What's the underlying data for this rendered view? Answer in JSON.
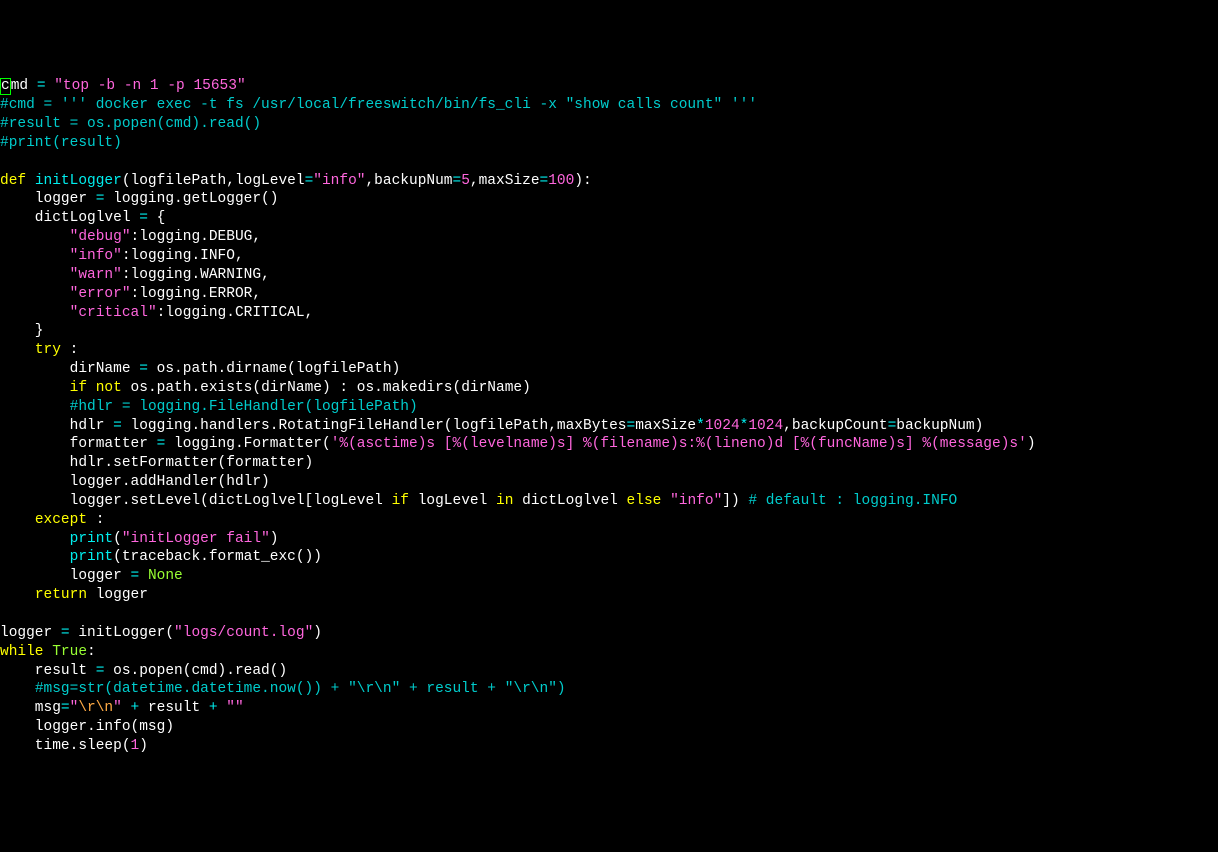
{
  "lines": [
    [
      {
        "cls": "white cursor",
        "t": "c"
      },
      {
        "cls": "white",
        "t": "md "
      },
      {
        "cls": "cyan",
        "t": "= "
      },
      {
        "cls": "pink",
        "t": "\"top -b -n 1 -p 15653\""
      }
    ],
    [
      {
        "cls": "teal",
        "t": "#cmd = ''' docker exec -t fs /usr/local/freeswitch/bin/fs_cli -x \"show calls count\" '''"
      }
    ],
    [
      {
        "cls": "teal",
        "t": "#result = os.popen(cmd).read()"
      }
    ],
    [
      {
        "cls": "teal",
        "t": "#print(result)"
      }
    ],
    [],
    [
      {
        "cls": "yellow",
        "t": "def "
      },
      {
        "cls": "cyan",
        "t": "initLogger"
      },
      {
        "cls": "white",
        "t": "(logfilePath,logLevel"
      },
      {
        "cls": "cyan",
        "t": "="
      },
      {
        "cls": "pink",
        "t": "\"info\""
      },
      {
        "cls": "white",
        "t": ",backupNum"
      },
      {
        "cls": "cyan",
        "t": "="
      },
      {
        "cls": "pink",
        "t": "5"
      },
      {
        "cls": "white",
        "t": ",maxSize"
      },
      {
        "cls": "cyan",
        "t": "="
      },
      {
        "cls": "pink",
        "t": "100"
      },
      {
        "cls": "white",
        "t": "):"
      }
    ],
    [
      {
        "cls": "white",
        "t": "    logger "
      },
      {
        "cls": "cyan",
        "t": "= "
      },
      {
        "cls": "white",
        "t": "logging.getLogger()"
      }
    ],
    [
      {
        "cls": "white",
        "t": "    dictLoglvel "
      },
      {
        "cls": "cyan",
        "t": "= "
      },
      {
        "cls": "white",
        "t": "{"
      }
    ],
    [
      {
        "cls": "white",
        "t": "        "
      },
      {
        "cls": "pink",
        "t": "\"debug\""
      },
      {
        "cls": "white",
        "t": ":logging.DEBUG,"
      }
    ],
    [
      {
        "cls": "white",
        "t": "        "
      },
      {
        "cls": "pink",
        "t": "\"info\""
      },
      {
        "cls": "white",
        "t": ":logging.INFO,"
      }
    ],
    [
      {
        "cls": "white",
        "t": "        "
      },
      {
        "cls": "pink",
        "t": "\"warn\""
      },
      {
        "cls": "white",
        "t": ":logging.WARNING,"
      }
    ],
    [
      {
        "cls": "white",
        "t": "        "
      },
      {
        "cls": "pink",
        "t": "\"error\""
      },
      {
        "cls": "white",
        "t": ":logging.ERROR,"
      }
    ],
    [
      {
        "cls": "white",
        "t": "        "
      },
      {
        "cls": "pink",
        "t": "\"critical\""
      },
      {
        "cls": "white",
        "t": ":logging.CRITICAL,"
      }
    ],
    [
      {
        "cls": "white",
        "t": "    }"
      }
    ],
    [
      {
        "cls": "white",
        "t": "    "
      },
      {
        "cls": "yellow",
        "t": "try "
      },
      {
        "cls": "white",
        "t": ":"
      }
    ],
    [
      {
        "cls": "white",
        "t": "        dirName "
      },
      {
        "cls": "cyan",
        "t": "= "
      },
      {
        "cls": "white",
        "t": "os.path.dirname(logfilePath)"
      }
    ],
    [
      {
        "cls": "white",
        "t": "        "
      },
      {
        "cls": "yellow",
        "t": "if "
      },
      {
        "cls": "yellow",
        "t": "not "
      },
      {
        "cls": "white",
        "t": "os.path.exists(dirName) : os.makedirs(dirName)"
      }
    ],
    [
      {
        "cls": "white",
        "t": "        "
      },
      {
        "cls": "teal",
        "t": "#hdlr = logging.FileHandler(logfilePath)"
      }
    ],
    [
      {
        "cls": "white",
        "t": "        hdlr "
      },
      {
        "cls": "cyan",
        "t": "= "
      },
      {
        "cls": "white",
        "t": "logging.handlers.RotatingFileHandler(logfilePath,maxBytes"
      },
      {
        "cls": "cyan",
        "t": "="
      },
      {
        "cls": "white",
        "t": "maxSize"
      },
      {
        "cls": "cyan",
        "t": "*"
      },
      {
        "cls": "pink",
        "t": "1024"
      },
      {
        "cls": "cyan",
        "t": "*"
      },
      {
        "cls": "pink",
        "t": "1024"
      },
      {
        "cls": "white",
        "t": ",backupCount"
      },
      {
        "cls": "cyan",
        "t": "="
      },
      {
        "cls": "white",
        "t": "backupNum)"
      }
    ],
    [
      {
        "cls": "white",
        "t": "        formatter "
      },
      {
        "cls": "cyan",
        "t": "= "
      },
      {
        "cls": "white",
        "t": "logging.Formatter("
      },
      {
        "cls": "pink",
        "t": "'%(asctime)s [%(levelname)s] %(filename)s:%(lineno)d [%(funcName)s] %(message)s'"
      },
      {
        "cls": "white",
        "t": ")"
      }
    ],
    [
      {
        "cls": "white",
        "t": "        hdlr.setFormatter(formatter)"
      }
    ],
    [
      {
        "cls": "white",
        "t": "        logger.addHandler(hdlr)"
      }
    ],
    [
      {
        "cls": "white",
        "t": "        logger.setLevel(dictLoglvel[logLevel "
      },
      {
        "cls": "yellow",
        "t": "if "
      },
      {
        "cls": "white",
        "t": "logLevel "
      },
      {
        "cls": "yellow",
        "t": "in "
      },
      {
        "cls": "white",
        "t": "dictLoglvel "
      },
      {
        "cls": "yellow",
        "t": "else "
      },
      {
        "cls": "pink",
        "t": "\"info\""
      },
      {
        "cls": "white",
        "t": "]) "
      },
      {
        "cls": "teal",
        "t": "# default : logging.INFO"
      }
    ],
    [
      {
        "cls": "white",
        "t": "    "
      },
      {
        "cls": "yellow",
        "t": "except "
      },
      {
        "cls": "white",
        "t": ":"
      }
    ],
    [
      {
        "cls": "white",
        "t": "        "
      },
      {
        "cls": "cyan",
        "t": "print"
      },
      {
        "cls": "white",
        "t": "("
      },
      {
        "cls": "pink",
        "t": "\"initLogger fail\""
      },
      {
        "cls": "white",
        "t": ")"
      }
    ],
    [
      {
        "cls": "white",
        "t": "        "
      },
      {
        "cls": "cyan",
        "t": "print"
      },
      {
        "cls": "white",
        "t": "(traceback.format_exc())"
      }
    ],
    [
      {
        "cls": "white",
        "t": "        logger "
      },
      {
        "cls": "cyan",
        "t": "= "
      },
      {
        "cls": "lime",
        "t": "None"
      }
    ],
    [
      {
        "cls": "white",
        "t": "    "
      },
      {
        "cls": "yellow",
        "t": "return "
      },
      {
        "cls": "white",
        "t": "logger"
      }
    ],
    [],
    [
      {
        "cls": "white",
        "t": "logger "
      },
      {
        "cls": "cyan",
        "t": "= "
      },
      {
        "cls": "white",
        "t": "initLogger("
      },
      {
        "cls": "pink",
        "t": "\"logs/count.log\""
      },
      {
        "cls": "white",
        "t": ")"
      }
    ],
    [
      {
        "cls": "yellow",
        "t": "while "
      },
      {
        "cls": "lime",
        "t": "True"
      },
      {
        "cls": "white",
        "t": ":"
      }
    ],
    [
      {
        "cls": "white",
        "t": "    result "
      },
      {
        "cls": "cyan",
        "t": "= "
      },
      {
        "cls": "white",
        "t": "os.popen(cmd).read()"
      }
    ],
    [
      {
        "cls": "white",
        "t": "    "
      },
      {
        "cls": "teal",
        "t": "#msg=str(datetime.datetime.now()) + \"\\r\\n\" + result + \"\\r\\n\")"
      }
    ],
    [
      {
        "cls": "white",
        "t": "    msg"
      },
      {
        "cls": "cyan",
        "t": "="
      },
      {
        "cls": "pink",
        "t": "\""
      },
      {
        "cls": "orange",
        "t": "\\r\\n"
      },
      {
        "cls": "pink",
        "t": "\" "
      },
      {
        "cls": "cyan",
        "t": "+ "
      },
      {
        "cls": "white",
        "t": "result "
      },
      {
        "cls": "cyan",
        "t": "+ "
      },
      {
        "cls": "pink",
        "t": "\"\""
      }
    ],
    [
      {
        "cls": "white",
        "t": "    logger.info(msg)"
      }
    ],
    [
      {
        "cls": "white",
        "t": "    time.sleep("
      },
      {
        "cls": "pink",
        "t": "1"
      },
      {
        "cls": "white",
        "t": ")"
      }
    ]
  ]
}
